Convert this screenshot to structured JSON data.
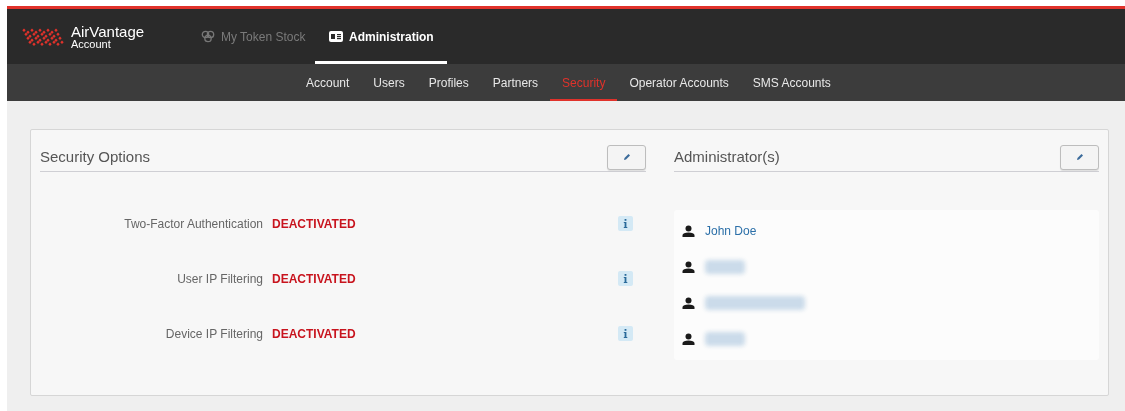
{
  "brand": {
    "name": "AirVantage",
    "sub": "Account"
  },
  "top_nav": [
    {
      "label": "My Token Stock",
      "kind": "tokens",
      "selected": false
    },
    {
      "label": "Administration",
      "kind": "card",
      "selected": true
    }
  ],
  "sub_nav": [
    {
      "label": "Account",
      "selected": false
    },
    {
      "label": "Users",
      "selected": false
    },
    {
      "label": "Profiles",
      "selected": false
    },
    {
      "label": "Partners",
      "selected": false
    },
    {
      "label": "Security",
      "selected": true
    },
    {
      "label": "Operator Accounts",
      "selected": false
    },
    {
      "label": "SMS Accounts",
      "selected": false
    }
  ],
  "security_options": {
    "title": "Security Options",
    "options": [
      {
        "label": "Two-Factor Authentication",
        "status": "DEACTIVATED",
        "active": false
      },
      {
        "label": "User IP Filtering",
        "status": "DEACTIVATED",
        "active": false
      },
      {
        "label": "Device IP Filtering",
        "status": "DEACTIVATED",
        "active": false
      }
    ]
  },
  "administrators": {
    "title": "Administrator(s)",
    "items": [
      {
        "kind": "name",
        "name": "John Doe"
      },
      {
        "kind": "redacted"
      },
      {
        "kind": "redacted"
      },
      {
        "kind": "redacted"
      }
    ]
  }
}
